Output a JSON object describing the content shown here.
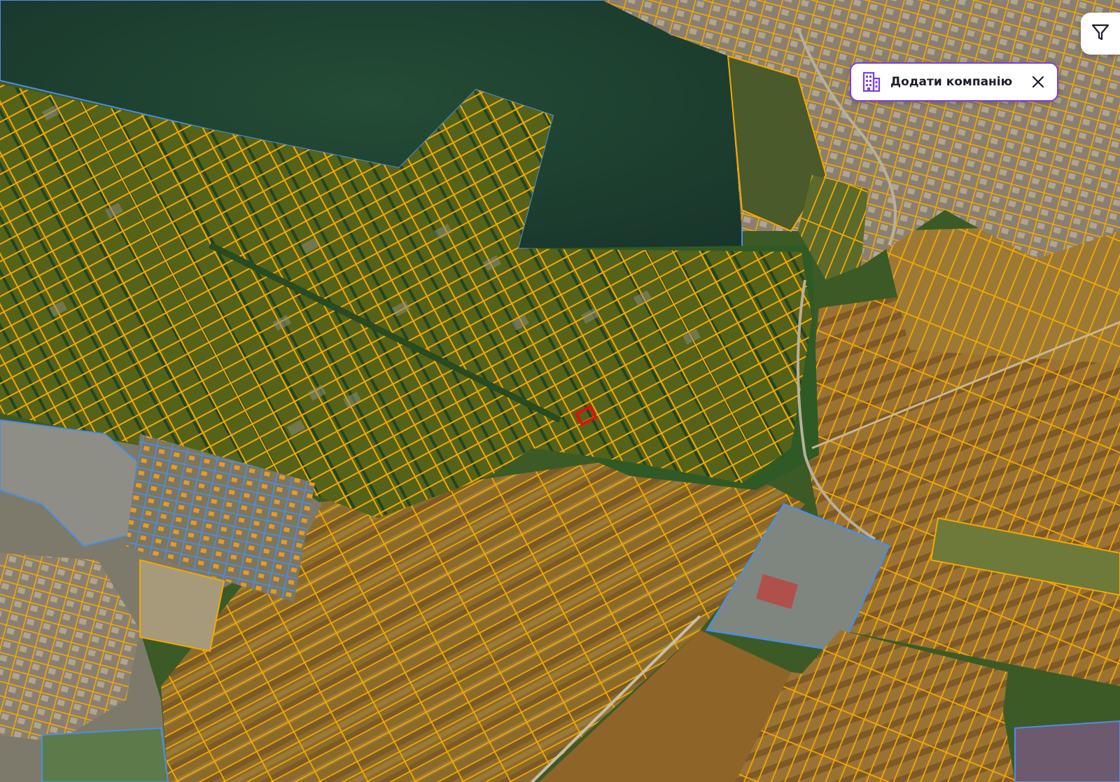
{
  "map": {
    "colors": {
      "forest": "#1f3d2c",
      "plot_area": "#4d5a16",
      "fields": "#8a6a2a",
      "parcel_outline": "#f5a800",
      "state_outline": "#4a8fe0",
      "selected_parcel": "#e01010"
    },
    "layers": [
      "satellite",
      "cadastral-parcels"
    ]
  },
  "add_company": {
    "icon": "building-icon",
    "label": "Додати компанію",
    "close_icon": "close-icon"
  },
  "filter": {
    "icon": "filter-icon"
  }
}
